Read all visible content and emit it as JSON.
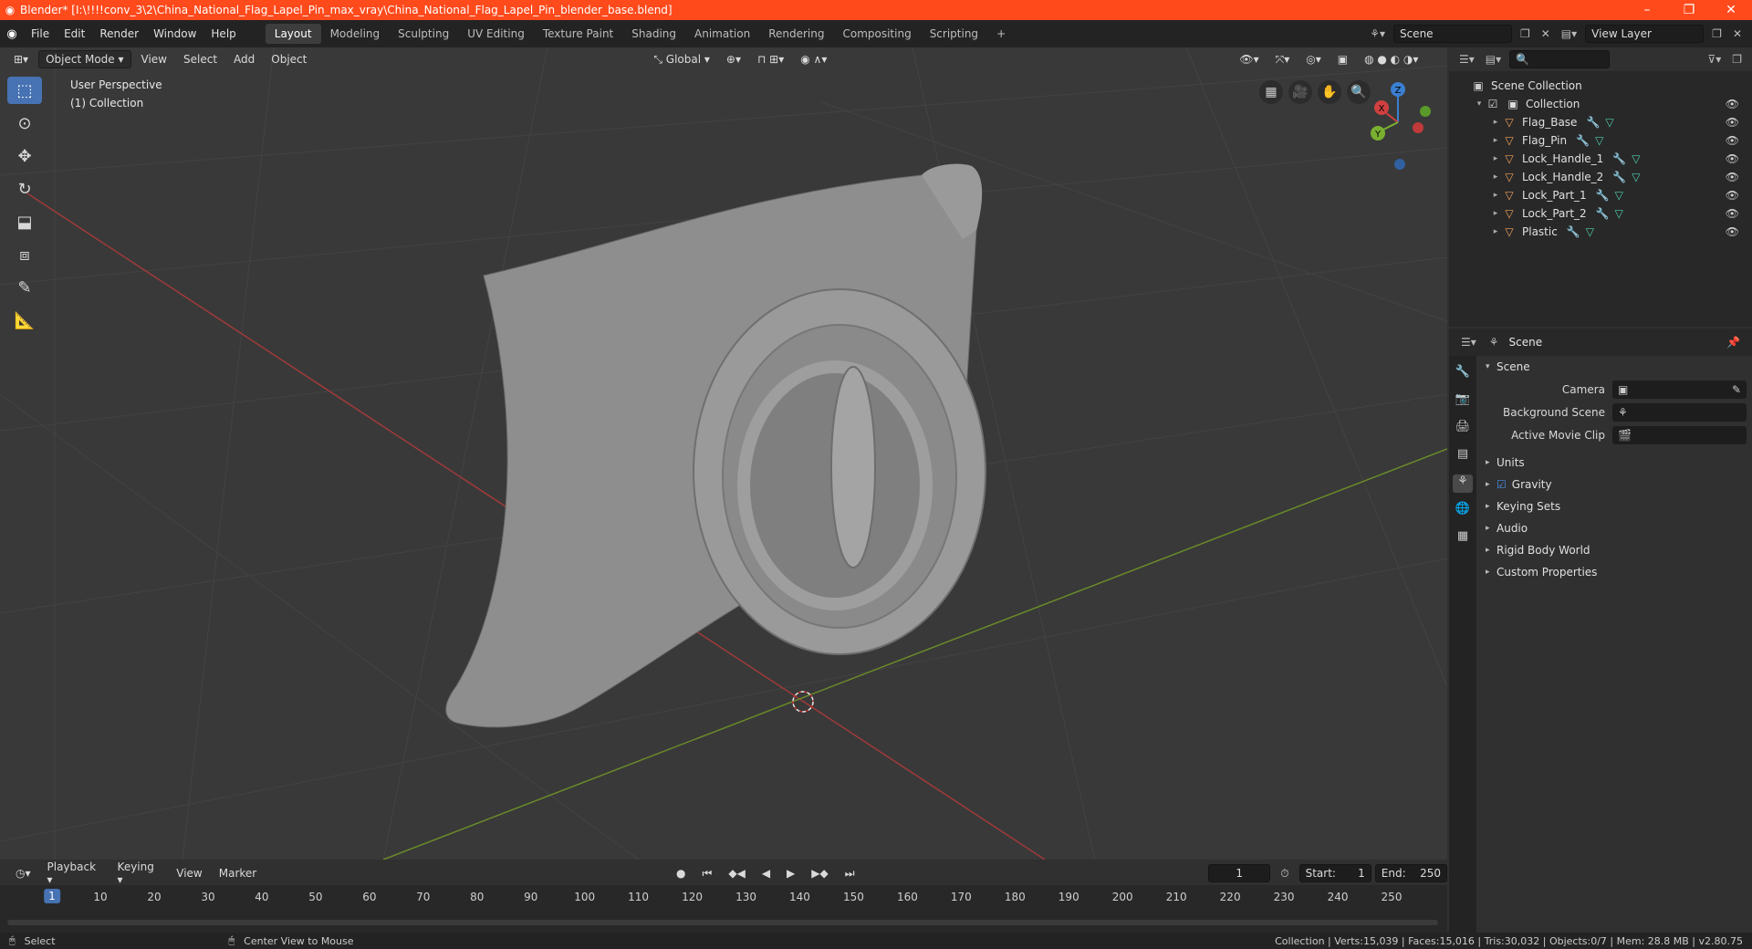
{
  "titlebar": {
    "title": "Blender* [I:\\!!!!conv_3\\2\\China_National_Flag_Lapel_Pin_max_vray\\China_National_Flag_Lapel_Pin_blender_base.blend]",
    "min": "–",
    "max": "❐",
    "close": "✕"
  },
  "menus": [
    "File",
    "Edit",
    "Render",
    "Window",
    "Help"
  ],
  "workspaces": [
    "Layout",
    "Modeling",
    "Sculpting",
    "UV Editing",
    "Texture Paint",
    "Shading",
    "Animation",
    "Rendering",
    "Compositing",
    "Scripting",
    "+"
  ],
  "scene_field": "Scene",
  "viewlayer_field": "View Layer",
  "viewport": {
    "mode": "Object Mode",
    "menus": [
      "View",
      "Select",
      "Add",
      "Object"
    ],
    "transform": "Global",
    "perspective": "User Perspective",
    "collection": "(1) Collection"
  },
  "gizmo": {
    "x": "X",
    "y": "Y",
    "z": "Z"
  },
  "outliner": {
    "root": "Scene Collection",
    "collection": "Collection",
    "objects": [
      {
        "name": "Flag_Base",
        "mods": true
      },
      {
        "name": "Flag_Pin",
        "mods": true
      },
      {
        "name": "Lock_Handle_1",
        "mods": true
      },
      {
        "name": "Lock_Handle_2",
        "mods": true
      },
      {
        "name": "Lock_Part_1",
        "mods": true
      },
      {
        "name": "Lock_Part_2",
        "mods": true
      },
      {
        "name": "Plastic",
        "mods": true
      }
    ]
  },
  "properties": {
    "header": "Scene",
    "section": "Scene",
    "fields": [
      {
        "label": "Camera",
        "value": ""
      },
      {
        "label": "Background Scene",
        "value": ""
      },
      {
        "label": "Active Movie Clip",
        "value": ""
      }
    ],
    "subsections": [
      "Units",
      "Gravity",
      "Keying Sets",
      "Audio",
      "Rigid Body World",
      "Custom Properties"
    ]
  },
  "timeline": {
    "menus": [
      "Playback",
      "Keying",
      "View",
      "Marker"
    ],
    "current": "1",
    "start_label": "Start:",
    "start": "1",
    "end_label": "End:",
    "end": "250",
    "ticks": [
      "10",
      "20",
      "30",
      "40",
      "50",
      "60",
      "70",
      "80",
      "90",
      "100",
      "110",
      "120",
      "130",
      "140",
      "150",
      "160",
      "170",
      "180",
      "190",
      "200",
      "210",
      "220",
      "230",
      "240",
      "250"
    ]
  },
  "status": {
    "left1": "Select",
    "left2": "Center View to Mouse",
    "right": "Collection | Verts:15,039 | Faces:15,016 | Tris:30,032 | Objects:0/7 | Mem: 28.8 MB | v2.80.75"
  }
}
